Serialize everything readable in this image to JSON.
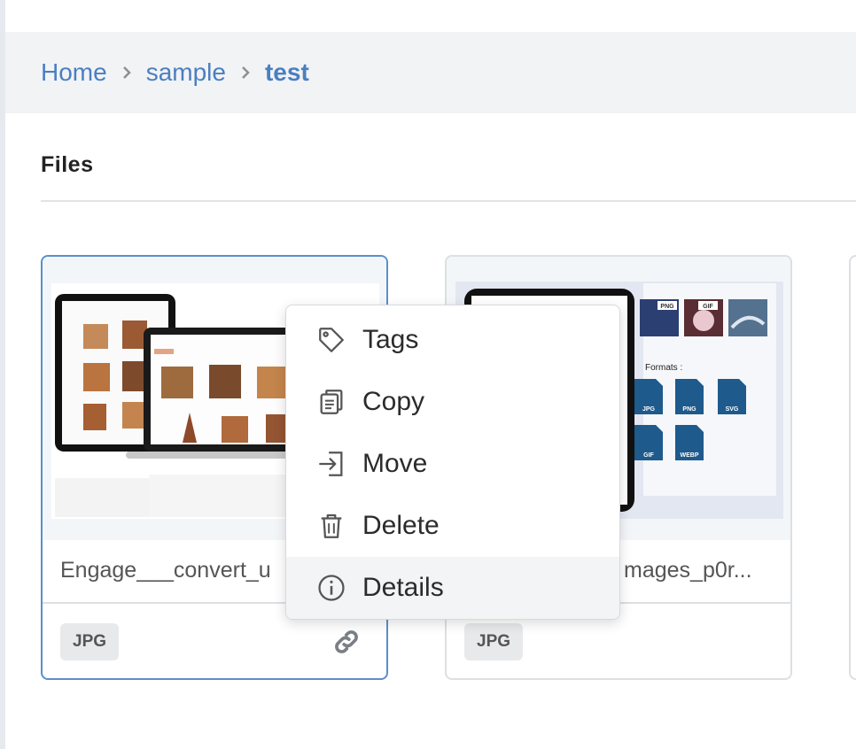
{
  "breadcrumb": {
    "items": [
      {
        "label": "Home"
      },
      {
        "label": "sample"
      },
      {
        "label": "test"
      }
    ]
  },
  "section": {
    "title": "Files"
  },
  "files": [
    {
      "name": "Engage___convert_u",
      "type": "JPG",
      "link_icon": "link-icon",
      "selected": true
    },
    {
      "name": "mages_p0r...",
      "type": "JPG",
      "selected": false
    }
  ],
  "thumb2": {
    "tiles": [
      "PNG",
      "GIF"
    ],
    "formats_title": "Formats :",
    "formats": [
      "JPG",
      "PNG",
      "SVG",
      "GIF",
      "WEBP"
    ]
  },
  "context_menu": {
    "items": [
      {
        "label": "Tags",
        "icon": "tag-icon"
      },
      {
        "label": "Copy",
        "icon": "copy-icon"
      },
      {
        "label": "Move",
        "icon": "move-icon"
      },
      {
        "label": "Delete",
        "icon": "trash-icon"
      },
      {
        "label": "Details",
        "icon": "info-icon"
      }
    ],
    "hovered": "Details"
  },
  "colors": {
    "accent": "#4a7fc1",
    "selected_border": "#5a8fcd",
    "breadcrumb_bg": "#f2f3f5"
  }
}
